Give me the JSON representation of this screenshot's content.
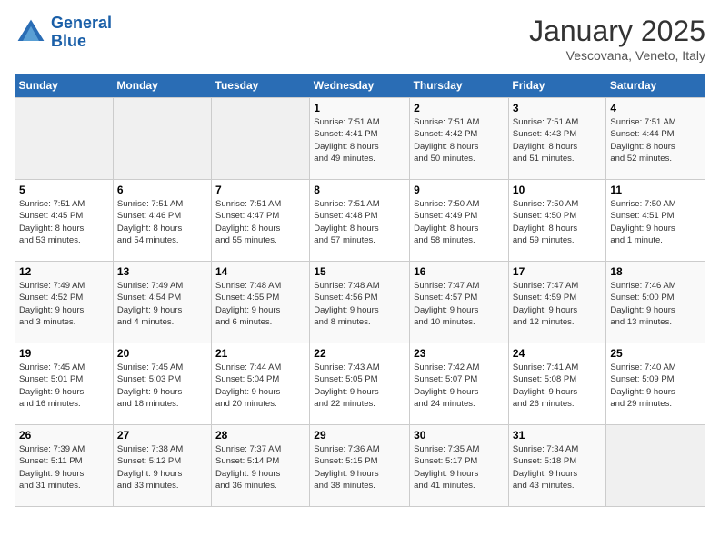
{
  "header": {
    "logo_line1": "General",
    "logo_line2": "Blue",
    "title": "January 2025",
    "subtitle": "Vescovana, Veneto, Italy"
  },
  "calendar": {
    "weekdays": [
      "Sunday",
      "Monday",
      "Tuesday",
      "Wednesday",
      "Thursday",
      "Friday",
      "Saturday"
    ],
    "weeks": [
      [
        {
          "day": "",
          "info": ""
        },
        {
          "day": "",
          "info": ""
        },
        {
          "day": "",
          "info": ""
        },
        {
          "day": "1",
          "info": "Sunrise: 7:51 AM\nSunset: 4:41 PM\nDaylight: 8 hours\nand 49 minutes."
        },
        {
          "day": "2",
          "info": "Sunrise: 7:51 AM\nSunset: 4:42 PM\nDaylight: 8 hours\nand 50 minutes."
        },
        {
          "day": "3",
          "info": "Sunrise: 7:51 AM\nSunset: 4:43 PM\nDaylight: 8 hours\nand 51 minutes."
        },
        {
          "day": "4",
          "info": "Sunrise: 7:51 AM\nSunset: 4:44 PM\nDaylight: 8 hours\nand 52 minutes."
        }
      ],
      [
        {
          "day": "5",
          "info": "Sunrise: 7:51 AM\nSunset: 4:45 PM\nDaylight: 8 hours\nand 53 minutes."
        },
        {
          "day": "6",
          "info": "Sunrise: 7:51 AM\nSunset: 4:46 PM\nDaylight: 8 hours\nand 54 minutes."
        },
        {
          "day": "7",
          "info": "Sunrise: 7:51 AM\nSunset: 4:47 PM\nDaylight: 8 hours\nand 55 minutes."
        },
        {
          "day": "8",
          "info": "Sunrise: 7:51 AM\nSunset: 4:48 PM\nDaylight: 8 hours\nand 57 minutes."
        },
        {
          "day": "9",
          "info": "Sunrise: 7:50 AM\nSunset: 4:49 PM\nDaylight: 8 hours\nand 58 minutes."
        },
        {
          "day": "10",
          "info": "Sunrise: 7:50 AM\nSunset: 4:50 PM\nDaylight: 8 hours\nand 59 minutes."
        },
        {
          "day": "11",
          "info": "Sunrise: 7:50 AM\nSunset: 4:51 PM\nDaylight: 9 hours\nand 1 minute."
        }
      ],
      [
        {
          "day": "12",
          "info": "Sunrise: 7:49 AM\nSunset: 4:52 PM\nDaylight: 9 hours\nand 3 minutes."
        },
        {
          "day": "13",
          "info": "Sunrise: 7:49 AM\nSunset: 4:54 PM\nDaylight: 9 hours\nand 4 minutes."
        },
        {
          "day": "14",
          "info": "Sunrise: 7:48 AM\nSunset: 4:55 PM\nDaylight: 9 hours\nand 6 minutes."
        },
        {
          "day": "15",
          "info": "Sunrise: 7:48 AM\nSunset: 4:56 PM\nDaylight: 9 hours\nand 8 minutes."
        },
        {
          "day": "16",
          "info": "Sunrise: 7:47 AM\nSunset: 4:57 PM\nDaylight: 9 hours\nand 10 minutes."
        },
        {
          "day": "17",
          "info": "Sunrise: 7:47 AM\nSunset: 4:59 PM\nDaylight: 9 hours\nand 12 minutes."
        },
        {
          "day": "18",
          "info": "Sunrise: 7:46 AM\nSunset: 5:00 PM\nDaylight: 9 hours\nand 13 minutes."
        }
      ],
      [
        {
          "day": "19",
          "info": "Sunrise: 7:45 AM\nSunset: 5:01 PM\nDaylight: 9 hours\nand 16 minutes."
        },
        {
          "day": "20",
          "info": "Sunrise: 7:45 AM\nSunset: 5:03 PM\nDaylight: 9 hours\nand 18 minutes."
        },
        {
          "day": "21",
          "info": "Sunrise: 7:44 AM\nSunset: 5:04 PM\nDaylight: 9 hours\nand 20 minutes."
        },
        {
          "day": "22",
          "info": "Sunrise: 7:43 AM\nSunset: 5:05 PM\nDaylight: 9 hours\nand 22 minutes."
        },
        {
          "day": "23",
          "info": "Sunrise: 7:42 AM\nSunset: 5:07 PM\nDaylight: 9 hours\nand 24 minutes."
        },
        {
          "day": "24",
          "info": "Sunrise: 7:41 AM\nSunset: 5:08 PM\nDaylight: 9 hours\nand 26 minutes."
        },
        {
          "day": "25",
          "info": "Sunrise: 7:40 AM\nSunset: 5:09 PM\nDaylight: 9 hours\nand 29 minutes."
        }
      ],
      [
        {
          "day": "26",
          "info": "Sunrise: 7:39 AM\nSunset: 5:11 PM\nDaylight: 9 hours\nand 31 minutes."
        },
        {
          "day": "27",
          "info": "Sunrise: 7:38 AM\nSunset: 5:12 PM\nDaylight: 9 hours\nand 33 minutes."
        },
        {
          "day": "28",
          "info": "Sunrise: 7:37 AM\nSunset: 5:14 PM\nDaylight: 9 hours\nand 36 minutes."
        },
        {
          "day": "29",
          "info": "Sunrise: 7:36 AM\nSunset: 5:15 PM\nDaylight: 9 hours\nand 38 minutes."
        },
        {
          "day": "30",
          "info": "Sunrise: 7:35 AM\nSunset: 5:17 PM\nDaylight: 9 hours\nand 41 minutes."
        },
        {
          "day": "31",
          "info": "Sunrise: 7:34 AM\nSunset: 5:18 PM\nDaylight: 9 hours\nand 43 minutes."
        },
        {
          "day": "",
          "info": ""
        }
      ]
    ]
  }
}
